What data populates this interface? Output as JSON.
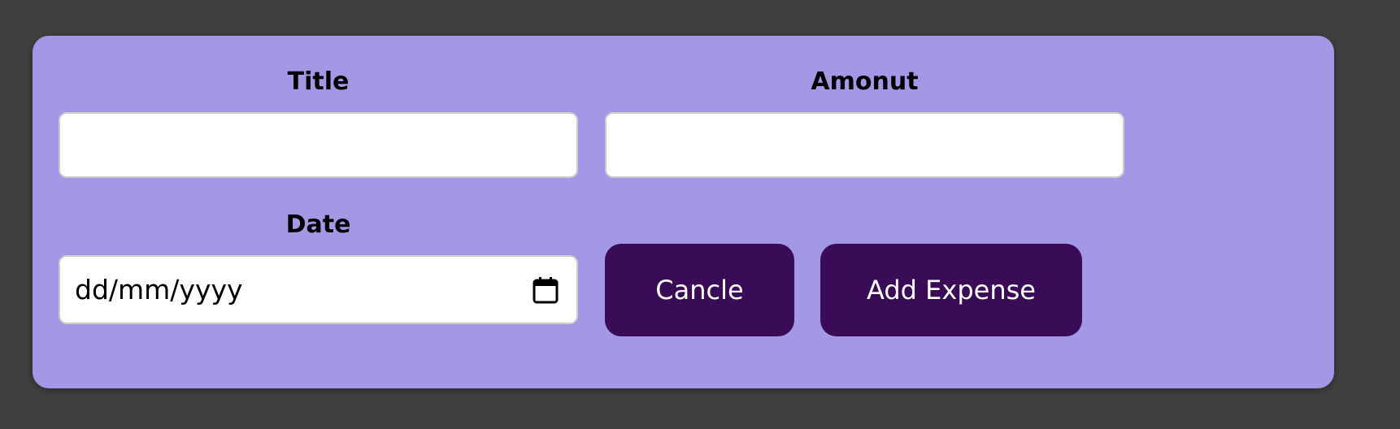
{
  "form": {
    "title_label": "Title",
    "title_value": "",
    "amount_label": "Amonut",
    "amount_value": "",
    "date_label": "Date",
    "date_placeholder": "dd/mm/yyyy",
    "cancel_label": "Cancle",
    "submit_label": "Add Expense"
  },
  "icons": {
    "date_picker": "calendar-icon"
  },
  "colors": {
    "page_background": "#3f3f3f",
    "card_background": "#a298e6",
    "button_background": "#3a0c58",
    "button_text": "#ffffff"
  }
}
